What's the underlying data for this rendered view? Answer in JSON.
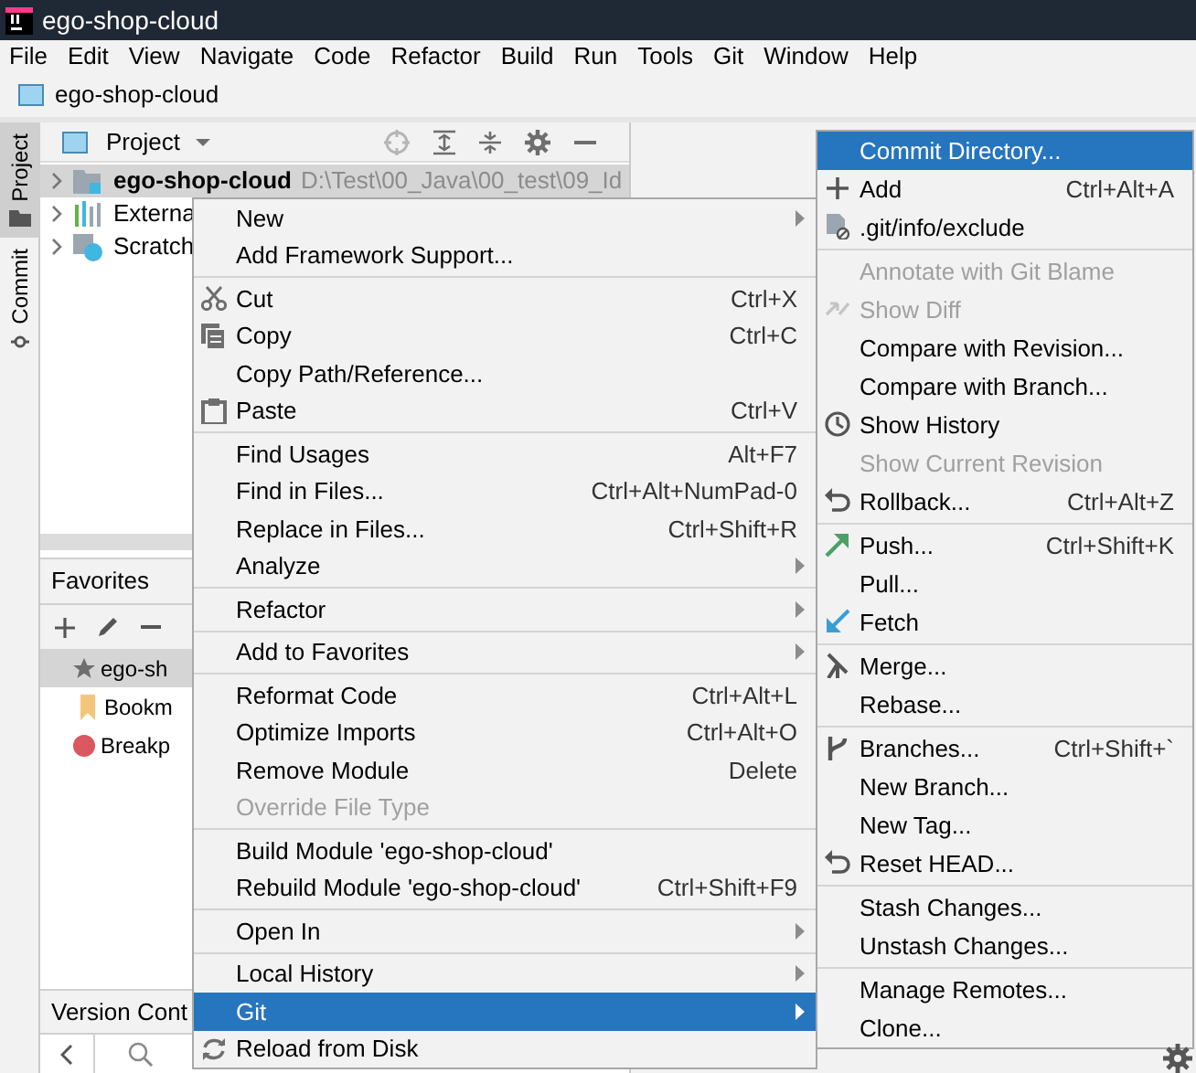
{
  "window": {
    "title": "ego-shop-cloud"
  },
  "menu_bar": [
    "File",
    "Edit",
    "View",
    "Navigate",
    "Code",
    "Refactor",
    "Build",
    "Run",
    "Tools",
    "Git",
    "Window",
    "Help"
  ],
  "nav_bar": {
    "path": "ego-shop-cloud"
  },
  "tool_strip": [
    {
      "label": "Project",
      "selected": true
    },
    {
      "label": "Commit",
      "selected": false
    }
  ],
  "project_panel": {
    "title": "Project",
    "tree": [
      {
        "label": "ego-shop-cloud",
        "path": "D:\\Test\\00_Java\\00_test\\09_Id",
        "kind": "module",
        "selected": true
      },
      {
        "label": "Externa",
        "kind": "libraries",
        "selected": false
      },
      {
        "label": "Scratch",
        "kind": "scratch",
        "selected": false
      }
    ]
  },
  "favorites_panel": {
    "title": "Favorites",
    "items": [
      {
        "label": "ego-sh",
        "kind": "star",
        "selected": true
      },
      {
        "label": "Bookm",
        "kind": "bookmark",
        "selected": false
      },
      {
        "label": "Breakp",
        "kind": "breakpoint",
        "selected": false
      }
    ]
  },
  "version_control": {
    "title": "Version Cont"
  },
  "context_menu": [
    {
      "kind": "item",
      "label": "New",
      "submenu": true,
      "disabled": false,
      "selected": false
    },
    {
      "kind": "item",
      "label": "Add Framework Support...",
      "submenu": false,
      "disabled": false,
      "selected": false
    },
    {
      "kind": "separator"
    },
    {
      "kind": "cut",
      "label": "Cut",
      "shortcut": "Ctrl+X",
      "submenu": false,
      "disabled": false,
      "selected": false
    },
    {
      "kind": "copy",
      "label": "Copy",
      "shortcut": "Ctrl+C",
      "submenu": false,
      "disabled": false,
      "selected": false
    },
    {
      "kind": "item",
      "label": "Copy Path/Reference...",
      "submenu": false,
      "disabled": false,
      "selected": false
    },
    {
      "kind": "paste",
      "label": "Paste",
      "shortcut": "Ctrl+V",
      "submenu": false,
      "disabled": false,
      "selected": false
    },
    {
      "kind": "separator"
    },
    {
      "kind": "item",
      "label": "Find Usages",
      "shortcut": "Alt+F7",
      "submenu": false,
      "disabled": false,
      "selected": false
    },
    {
      "kind": "item",
      "label": "Find in Files...",
      "shortcut": "Ctrl+Alt+NumPad-0",
      "submenu": false,
      "disabled": false,
      "selected": false
    },
    {
      "kind": "item",
      "label": "Replace in Files...",
      "shortcut": "Ctrl+Shift+R",
      "submenu": false,
      "disabled": false,
      "selected": false
    },
    {
      "kind": "item",
      "label": "Analyze",
      "submenu": true,
      "disabled": false,
      "selected": false
    },
    {
      "kind": "separator"
    },
    {
      "kind": "item",
      "label": "Refactor",
      "submenu": true,
      "disabled": false,
      "selected": false
    },
    {
      "kind": "separator"
    },
    {
      "kind": "item",
      "label": "Add to Favorites",
      "submenu": true,
      "disabled": false,
      "selected": false
    },
    {
      "kind": "separator"
    },
    {
      "kind": "item",
      "label": "Reformat Code",
      "shortcut": "Ctrl+Alt+L",
      "submenu": false,
      "disabled": false,
      "selected": false
    },
    {
      "kind": "item",
      "label": "Optimize Imports",
      "shortcut": "Ctrl+Alt+O",
      "submenu": false,
      "disabled": false,
      "selected": false
    },
    {
      "kind": "item",
      "label": "Remove Module",
      "shortcut": "Delete",
      "submenu": false,
      "disabled": false,
      "selected": false
    },
    {
      "kind": "item",
      "label": "Override File Type",
      "submenu": false,
      "disabled": true,
      "selected": false
    },
    {
      "kind": "separator"
    },
    {
      "kind": "item",
      "label": "Build Module 'ego-shop-cloud'",
      "submenu": false,
      "disabled": false,
      "selected": false
    },
    {
      "kind": "item",
      "label": "Rebuild Module 'ego-shop-cloud'",
      "shortcut": "Ctrl+Shift+F9",
      "submenu": false,
      "disabled": false,
      "selected": false
    },
    {
      "kind": "separator"
    },
    {
      "kind": "item",
      "label": "Open In",
      "submenu": true,
      "disabled": false,
      "selected": false
    },
    {
      "kind": "separator"
    },
    {
      "kind": "item",
      "label": "Local History",
      "submenu": true,
      "disabled": false,
      "selected": false
    },
    {
      "kind": "item",
      "label": "Git",
      "submenu": true,
      "disabled": false,
      "selected": true
    },
    {
      "kind": "reload",
      "label": "Reload from Disk",
      "submenu": false,
      "disabled": false,
      "selected": false
    }
  ],
  "git_menu": [
    {
      "kind": "item",
      "label": "Commit Directory...",
      "submenu": false,
      "disabled": false,
      "selected": true
    },
    {
      "kind": "add",
      "label": "Add",
      "shortcut": "Ctrl+Alt+A",
      "submenu": false,
      "disabled": false,
      "selected": false
    },
    {
      "kind": "exclude",
      "label": ".git/info/exclude",
      "submenu": false,
      "disabled": false,
      "selected": false
    },
    {
      "kind": "separator"
    },
    {
      "kind": "item",
      "label": "Annotate with Git Blame",
      "submenu": false,
      "disabled": true,
      "selected": false
    },
    {
      "kind": "diff",
      "label": "Show Diff",
      "submenu": false,
      "disabled": true,
      "selected": false
    },
    {
      "kind": "item",
      "label": "Compare with Revision...",
      "submenu": false,
      "disabled": false,
      "selected": false
    },
    {
      "kind": "item",
      "label": "Compare with Branch...",
      "submenu": false,
      "disabled": false,
      "selected": false
    },
    {
      "kind": "history",
      "label": "Show History",
      "submenu": false,
      "disabled": false,
      "selected": false
    },
    {
      "kind": "item",
      "label": "Show Current Revision",
      "submenu": false,
      "disabled": true,
      "selected": false
    },
    {
      "kind": "rollback",
      "label": "Rollback...",
      "shortcut": "Ctrl+Alt+Z",
      "submenu": false,
      "disabled": false,
      "selected": false
    },
    {
      "kind": "separator"
    },
    {
      "kind": "push",
      "label": "Push...",
      "shortcut": "Ctrl+Shift+K",
      "submenu": false,
      "disabled": false,
      "selected": false
    },
    {
      "kind": "item",
      "label": "Pull...",
      "submenu": false,
      "disabled": false,
      "selected": false
    },
    {
      "kind": "fetch",
      "label": "Fetch",
      "submenu": false,
      "disabled": false,
      "selected": false
    },
    {
      "kind": "separator"
    },
    {
      "kind": "merge",
      "label": "Merge...",
      "submenu": false,
      "disabled": false,
      "selected": false
    },
    {
      "kind": "item",
      "label": "Rebase...",
      "submenu": false,
      "disabled": false,
      "selected": false
    },
    {
      "kind": "separator"
    },
    {
      "kind": "branches",
      "label": "Branches...",
      "shortcut": "Ctrl+Shift+`",
      "submenu": false,
      "disabled": false,
      "selected": false
    },
    {
      "kind": "item",
      "label": "New Branch...",
      "submenu": false,
      "disabled": false,
      "selected": false
    },
    {
      "kind": "item",
      "label": "New Tag...",
      "submenu": false,
      "disabled": false,
      "selected": false
    },
    {
      "kind": "rollback",
      "label": "Reset HEAD...",
      "submenu": false,
      "disabled": false,
      "selected": false
    },
    {
      "kind": "separator"
    },
    {
      "kind": "item",
      "label": "Stash Changes...",
      "submenu": false,
      "disabled": false,
      "selected": false
    },
    {
      "kind": "item",
      "label": "Unstash Changes...",
      "submenu": false,
      "disabled": false,
      "selected": false
    },
    {
      "kind": "separator"
    },
    {
      "kind": "item",
      "label": "Manage Remotes...",
      "submenu": false,
      "disabled": false,
      "selected": false
    },
    {
      "kind": "item",
      "label": "Clone...",
      "submenu": false,
      "disabled": false,
      "selected": false
    }
  ]
}
